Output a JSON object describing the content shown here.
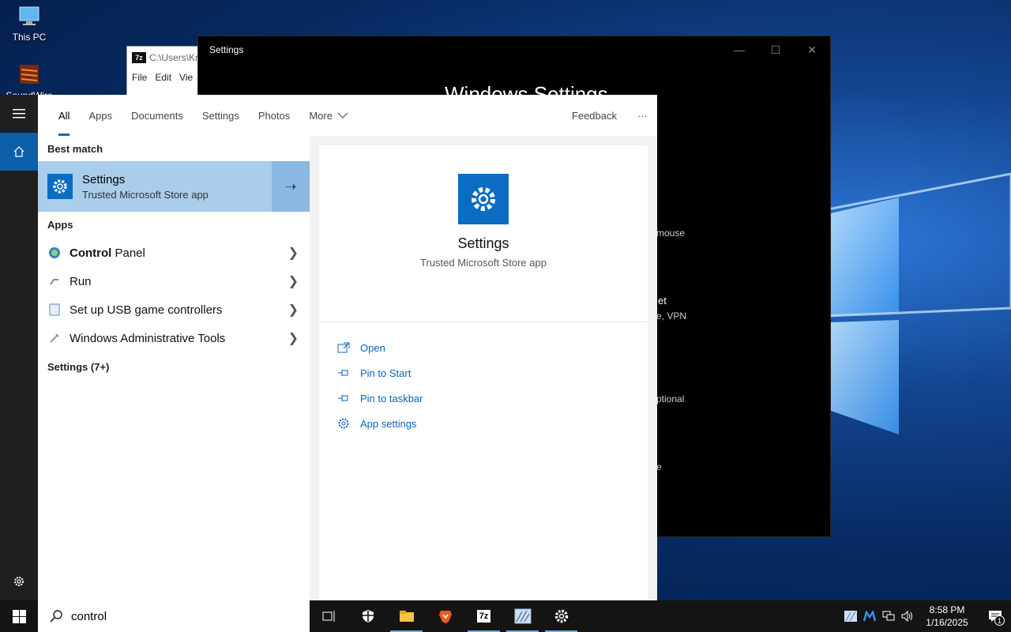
{
  "desktop": {
    "icons": [
      {
        "label": "This PC",
        "icon": "computer-icon"
      },
      {
        "label": "SoundWire",
        "icon": "soundwire-icon"
      }
    ]
  },
  "window_7z": {
    "title": "C:\\Users\\Kr",
    "menu": [
      "File",
      "Edit",
      "Vie"
    ]
  },
  "settings_window": {
    "title": "Settings",
    "heading": "Windows Settings",
    "peek_texts": [
      "mouse",
      "et",
      "e, VPN",
      "ptional",
      "e"
    ]
  },
  "search_panel": {
    "tabs": [
      "All",
      "Apps",
      "Documents",
      "Settings",
      "Photos",
      "More"
    ],
    "active_tab": "All",
    "feedback": "Feedback",
    "more_dots": "···",
    "best_match_heading": "Best match",
    "best_match": {
      "title": "Settings",
      "subtitle": "Trusted Microsoft Store app"
    },
    "apps_heading": "Apps",
    "apps": [
      {
        "bold": "Control",
        "rest": " Panel",
        "icon": "control-panel-icon"
      },
      {
        "bold": "",
        "rest": "Run",
        "icon": "run-icon"
      },
      {
        "bold": "",
        "rest": "Set up USB game controllers",
        "icon": "usb-controller-icon"
      },
      {
        "bold": "",
        "rest": "Windows Administrative Tools",
        "icon": "admin-tools-icon"
      }
    ],
    "settings_heading": "Settings (7+)",
    "preview": {
      "title": "Settings",
      "subtitle": "Trusted Microsoft Store app",
      "actions": [
        {
          "label": "Open",
          "icon": "open-icon"
        },
        {
          "label": "Pin to Start",
          "icon": "pin-icon"
        },
        {
          "label": "Pin to taskbar",
          "icon": "pin-icon"
        },
        {
          "label": "App settings",
          "icon": "gear-icon"
        }
      ]
    }
  },
  "taskbar": {
    "search_value": "control",
    "apps": [
      "task-view-icon",
      "security-shield-icon",
      "file-explorer-icon",
      "brave-browser-icon",
      "7zip-icon",
      "image-app-icon",
      "settings-gear-icon"
    ],
    "time": "8:58 PM",
    "date": "1/16/2025",
    "notification_count": "1"
  },
  "colors": {
    "accent": "#0a6cc2",
    "selection": "#a9cdeb",
    "taskbar": "#141414"
  }
}
